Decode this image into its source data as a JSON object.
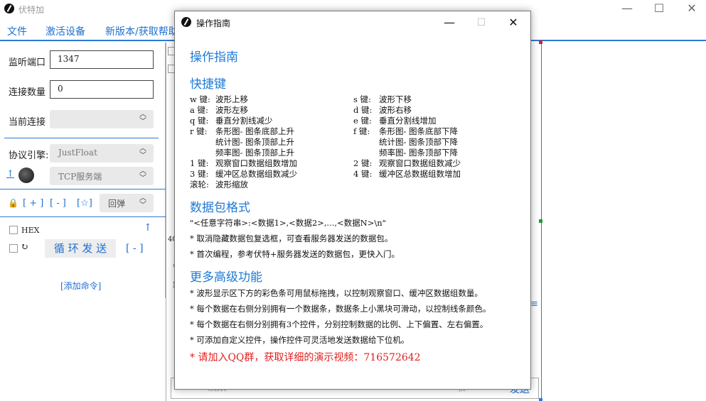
{
  "window": {
    "title": "伏特加",
    "min": "—",
    "max": "☐",
    "close": "✕"
  },
  "menu": [
    "文件",
    "激活设备",
    "新版本/获取帮助"
  ],
  "left": {
    "port_label": "监听端口",
    "port_value": "1347",
    "conn_count_label": "连接数量",
    "conn_count_value": "0",
    "current_conn_label": "当前连接",
    "current_conn_value": "",
    "engine_label": "协议引擎:",
    "engine_value": "JustFloat",
    "server_value": "TCP服务端",
    "cmd_plus": "[ + ]",
    "cmd_minus": "[ - ]",
    "cmd_star": "[☆]",
    "echo_value": "回弹",
    "hex_label": "HEX",
    "loop_send": "循 环 发 送",
    "loop_minus": "[ - ]",
    "add_command": "[添加命令]"
  },
  "background": {
    "text_40": "40",
    "text_ca": "ca",
    "text_i": "I",
    "combo1": "GBK",
    "combo2": "\\n",
    "send": "发送"
  },
  "dialog": {
    "title": "操作指南",
    "h_guide": "操作指南",
    "h_shortcuts": "快捷键",
    "shortcuts_left": [
      {
        "key": "w 键:",
        "desc": "波形上移"
      },
      {
        "key": "a 键:",
        "desc": "波形左移"
      },
      {
        "key": "q 键:",
        "desc": "垂直分割线减少"
      },
      {
        "key": "r 键:",
        "desc": "条形图- 图条底部上升"
      },
      {
        "key": "",
        "desc": "统计图- 图条顶部上升"
      },
      {
        "key": "",
        "desc": "频率图- 图条顶部上升"
      },
      {
        "key": "1 键:",
        "desc": "观察窗口数据组数增加"
      },
      {
        "key": "3 键:",
        "desc": "缓冲区总数据组数减少"
      },
      {
        "key": "滚轮:",
        "desc": "波形缩放"
      }
    ],
    "shortcuts_right": [
      {
        "key": "s 键:",
        "desc": "波形下移"
      },
      {
        "key": "d 键:",
        "desc": "波形右移"
      },
      {
        "key": "e 键:",
        "desc": "垂直分割线增加"
      },
      {
        "key": "f 键:",
        "desc": "条形图- 图条底部下降"
      },
      {
        "key": "",
        "desc": "统计图- 图条顶部下降"
      },
      {
        "key": "",
        "desc": "频率图- 图条顶部下降"
      },
      {
        "key": "2 键:",
        "desc": "观察窗口数据组数减少"
      },
      {
        "key": "4 键:",
        "desc": "缓冲区总数据组数增加"
      }
    ],
    "h_packet": "数据包格式",
    "packet_format": "\"<任意字符串>:<数据1>,<数据2>,...,<数据N>\\n\"",
    "packet_notes": [
      "* 取消隐藏数据包复选框，可查看服务器发送的数据包。",
      "* 首次编程，参考伏特+服务器发送的数据包，更快入门。"
    ],
    "h_advanced": "更多高级功能",
    "advanced_notes": [
      "* 波形显示区下方的彩色条可用鼠标拖拽，以控制观察窗口、缓冲区数据组数量。",
      "* 每个数据在右侧分别拥有一个数据条，数据条上小黑块可滑动，以控制线条颜色。",
      "* 每个数据在右侧分别拥有3个控件，分别控制数据的比例、上下偏置、左右偏置。",
      "* 可添加自定义控件，操作控件可灵活地发送数据给下位机。"
    ],
    "qq_note": "* 请加入QQ群，获取详细的演示视频：716572642"
  }
}
